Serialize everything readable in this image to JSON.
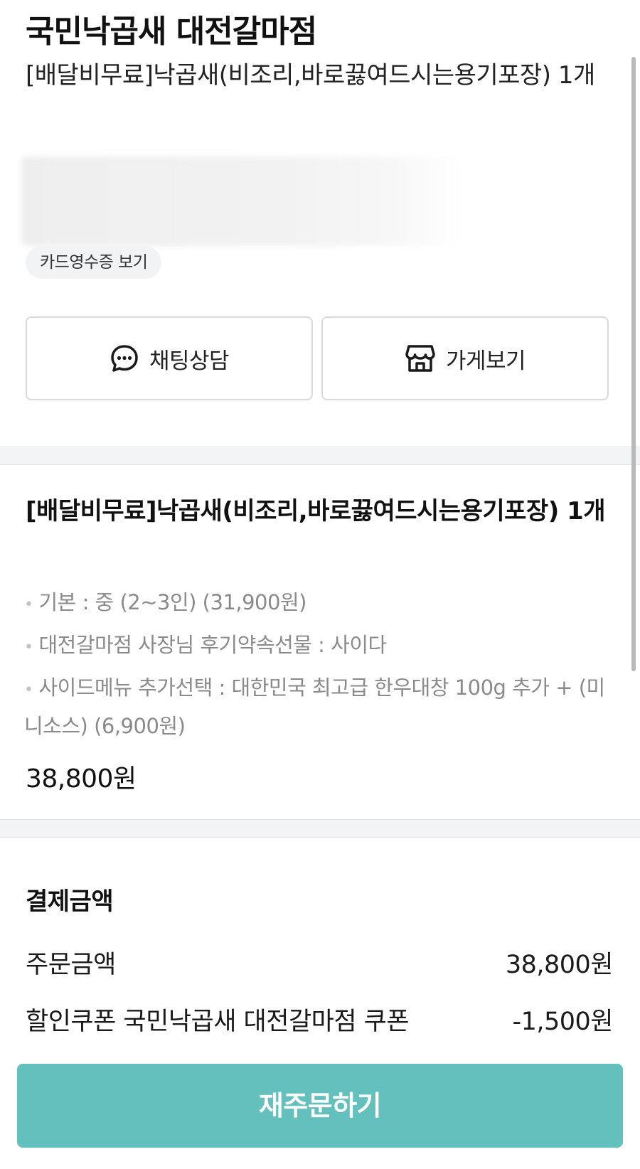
{
  "store": {
    "name": "국민낙곱새 대전갈마점",
    "order_summary": "[배달비무료]낙곱새(비조리,바로끓여드시는용기포장) 1개"
  },
  "receipt_chip": "카드영수증 보기",
  "actions": {
    "chat_label": "채팅상담",
    "store_label": "가게보기"
  },
  "menu": {
    "name": "[배달비무료]낙곱새(비조리,바로끓여드시는용기포장) 1개",
    "options": [
      "기본 : 중 (2~3인) (31,900원)",
      "대전갈마점 사장님 후기약속선물 : 사이다",
      "사이드메뉴 추가선택 : 대한민국 최고급 한우대창 100g 추가 + (미니소스) (6,900원)"
    ],
    "price": "38,800원"
  },
  "payment": {
    "title": "결제금액",
    "rows": [
      {
        "label": "주문금액",
        "value": "38,800원"
      },
      {
        "label": "할인쿠폰 국민낙곱새 대전갈마점 쿠폰",
        "value": "-1,500원"
      }
    ]
  },
  "reorder_label": "재주문하기",
  "colors": {
    "accent": "#63c0bc",
    "divider": "#f3f4f6",
    "option_text": "#8a8a8a"
  },
  "icons": {
    "chat": "chat-bubble-icon",
    "store": "store-icon"
  }
}
